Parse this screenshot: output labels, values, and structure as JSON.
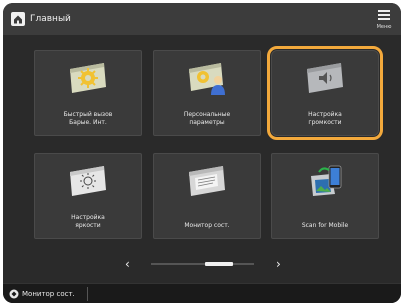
{
  "header": {
    "title": "Главный",
    "menu_label": "Меню"
  },
  "tiles": [
    {
      "label": "Быстрый вызов\nБарые. Инт.",
      "icon": "gear-cube-icon"
    },
    {
      "label": "Персональные\nпараметры",
      "icon": "personal-settings-icon"
    },
    {
      "label": "Настройка\nгромкости",
      "icon": "volume-icon"
    },
    {
      "label": "Настройка\nяркости",
      "icon": "brightness-icon"
    },
    {
      "label": "Монитор сост.",
      "icon": "status-monitor-icon"
    },
    {
      "label": "Scan for Mobile",
      "icon": "scan-mobile-icon"
    }
  ],
  "pager": {
    "prev": "‹",
    "next": "›"
  },
  "footer": {
    "status_label": "Монитор сост."
  },
  "colors": {
    "selection": "#f3a93c"
  }
}
